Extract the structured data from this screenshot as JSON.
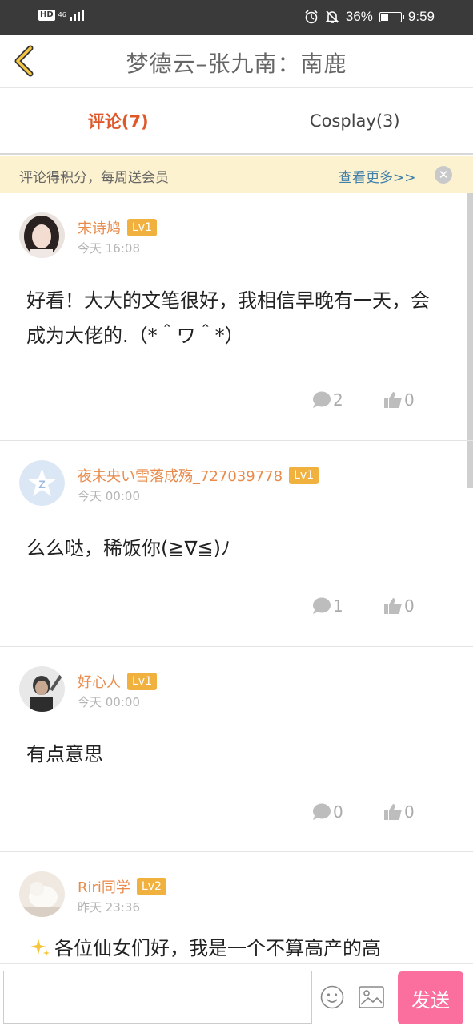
{
  "status_bar": {
    "hd": "HD",
    "network": "46",
    "battery_pct": "36%",
    "battery_level": 0.36,
    "time": "9:59",
    "icons": [
      "alarm-icon",
      "mute-icon",
      "battery-icon"
    ]
  },
  "header": {
    "title": "梦德云–张九南：南鹿",
    "back_icon": "chevron-left-icon"
  },
  "tabs": [
    {
      "label": "评论(7)",
      "active": true
    },
    {
      "label": "Cosplay(3)",
      "active": false
    }
  ],
  "notice": {
    "text": "评论得积分，每周送会员",
    "more": "查看更多>>",
    "close_icon": "close-icon"
  },
  "comments": [
    {
      "user": "宋诗鸠",
      "level": "Lv1",
      "time": "今天 16:08",
      "text": "好看！大大的文笔很好，我相信早晚有一天，会成为大佬的.（*＾ワ＾*）",
      "replies": "2",
      "likes": "0"
    },
    {
      "user": "夜未央い雪落成殇_727039778",
      "level": "Lv1",
      "time": "今天 00:00",
      "text": "么么哒，稀饭你(≧∇≦)ﾉ",
      "replies": "1",
      "likes": "0"
    },
    {
      "user": "好心人",
      "level": "Lv1",
      "time": "今天 00:00",
      "text": "有点意思",
      "replies": "0",
      "likes": "0"
    },
    {
      "user": "Riri同学",
      "level": "Lv2",
      "time": "昨天 23:36",
      "text": "各位仙女们好，我是一个不算高产的高",
      "replies": "",
      "likes": ""
    }
  ],
  "composer": {
    "placeholder": "",
    "send_label": "发送",
    "emoji_icon": "smile-icon",
    "image_icon": "image-icon"
  },
  "colors": {
    "accent": "#e0582a",
    "username": "#e88a4a",
    "level_badge": "#f1b13f",
    "send_button": "#fa6f9e",
    "notice_bg": "#fdf2cf",
    "link": "#3f7faa"
  }
}
